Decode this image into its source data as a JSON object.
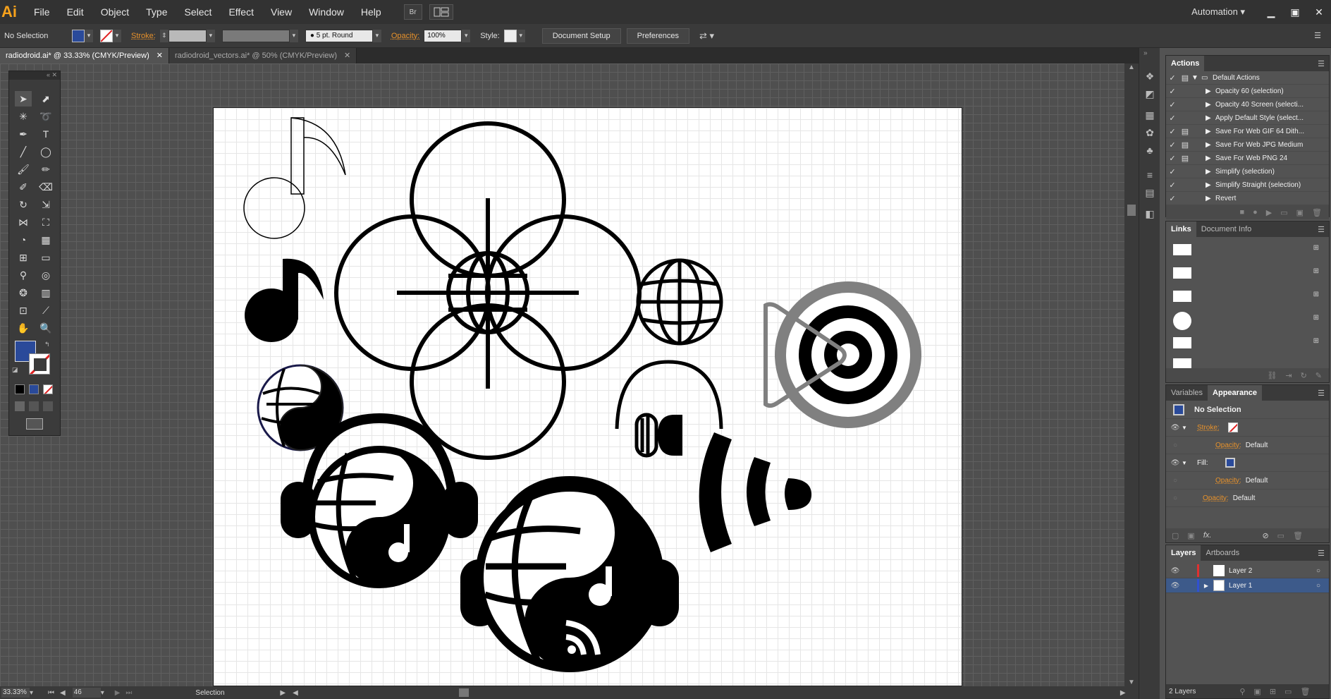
{
  "app": {
    "logo": "Ai"
  },
  "menu": [
    "File",
    "Edit",
    "Object",
    "Type",
    "Select",
    "Effect",
    "View",
    "Window",
    "Help"
  ],
  "toolbar_br": "Br",
  "workspace": "Automation",
  "control": {
    "selection": "No Selection",
    "stroke_label": "Stroke:",
    "brush": "5 pt. Round",
    "opacity_label": "Opacity:",
    "opacity": "100%",
    "style_label": "Style:",
    "document_setup": "Document Setup",
    "preferences": "Preferences"
  },
  "tabs": [
    {
      "label": "radiodroid.ai* @ 33.33% (CMYK/Preview)"
    },
    {
      "label": "radiodroid_vectors.ai* @ 50% (CMYK/Preview)"
    }
  ],
  "status": {
    "zoom": "33.33%",
    "artboard": "46",
    "tool": "Selection"
  },
  "actions": {
    "title": "Actions",
    "set": "Default Actions",
    "items": [
      "Opacity 60 (selection)",
      "Opacity 40 Screen (selecti...",
      "Apply Default Style (select...",
      "Save For Web GIF 64 Dith...",
      "Save For Web JPG Medium",
      "Save For Web PNG 24",
      "Simplify (selection)",
      "Simplify Straight (selection)",
      "Revert"
    ]
  },
  "links": {
    "tab1": "Links",
    "tab2": "Document Info"
  },
  "appearance": {
    "tab1": "Variables",
    "tab2": "Appearance",
    "selection": "No Selection",
    "stroke": "Stroke:",
    "fill": "Fill:",
    "opacity": "Opacity:",
    "default": "Default"
  },
  "layers": {
    "tab1": "Layers",
    "tab2": "Artboards",
    "items": [
      "Layer 2",
      "Layer 1"
    ],
    "count": "2 Layers"
  },
  "colors": {
    "fill": "#2a4a9a",
    "accent": "#e8922b",
    "layer2": "#e03030",
    "layer1": "#3050d0"
  }
}
